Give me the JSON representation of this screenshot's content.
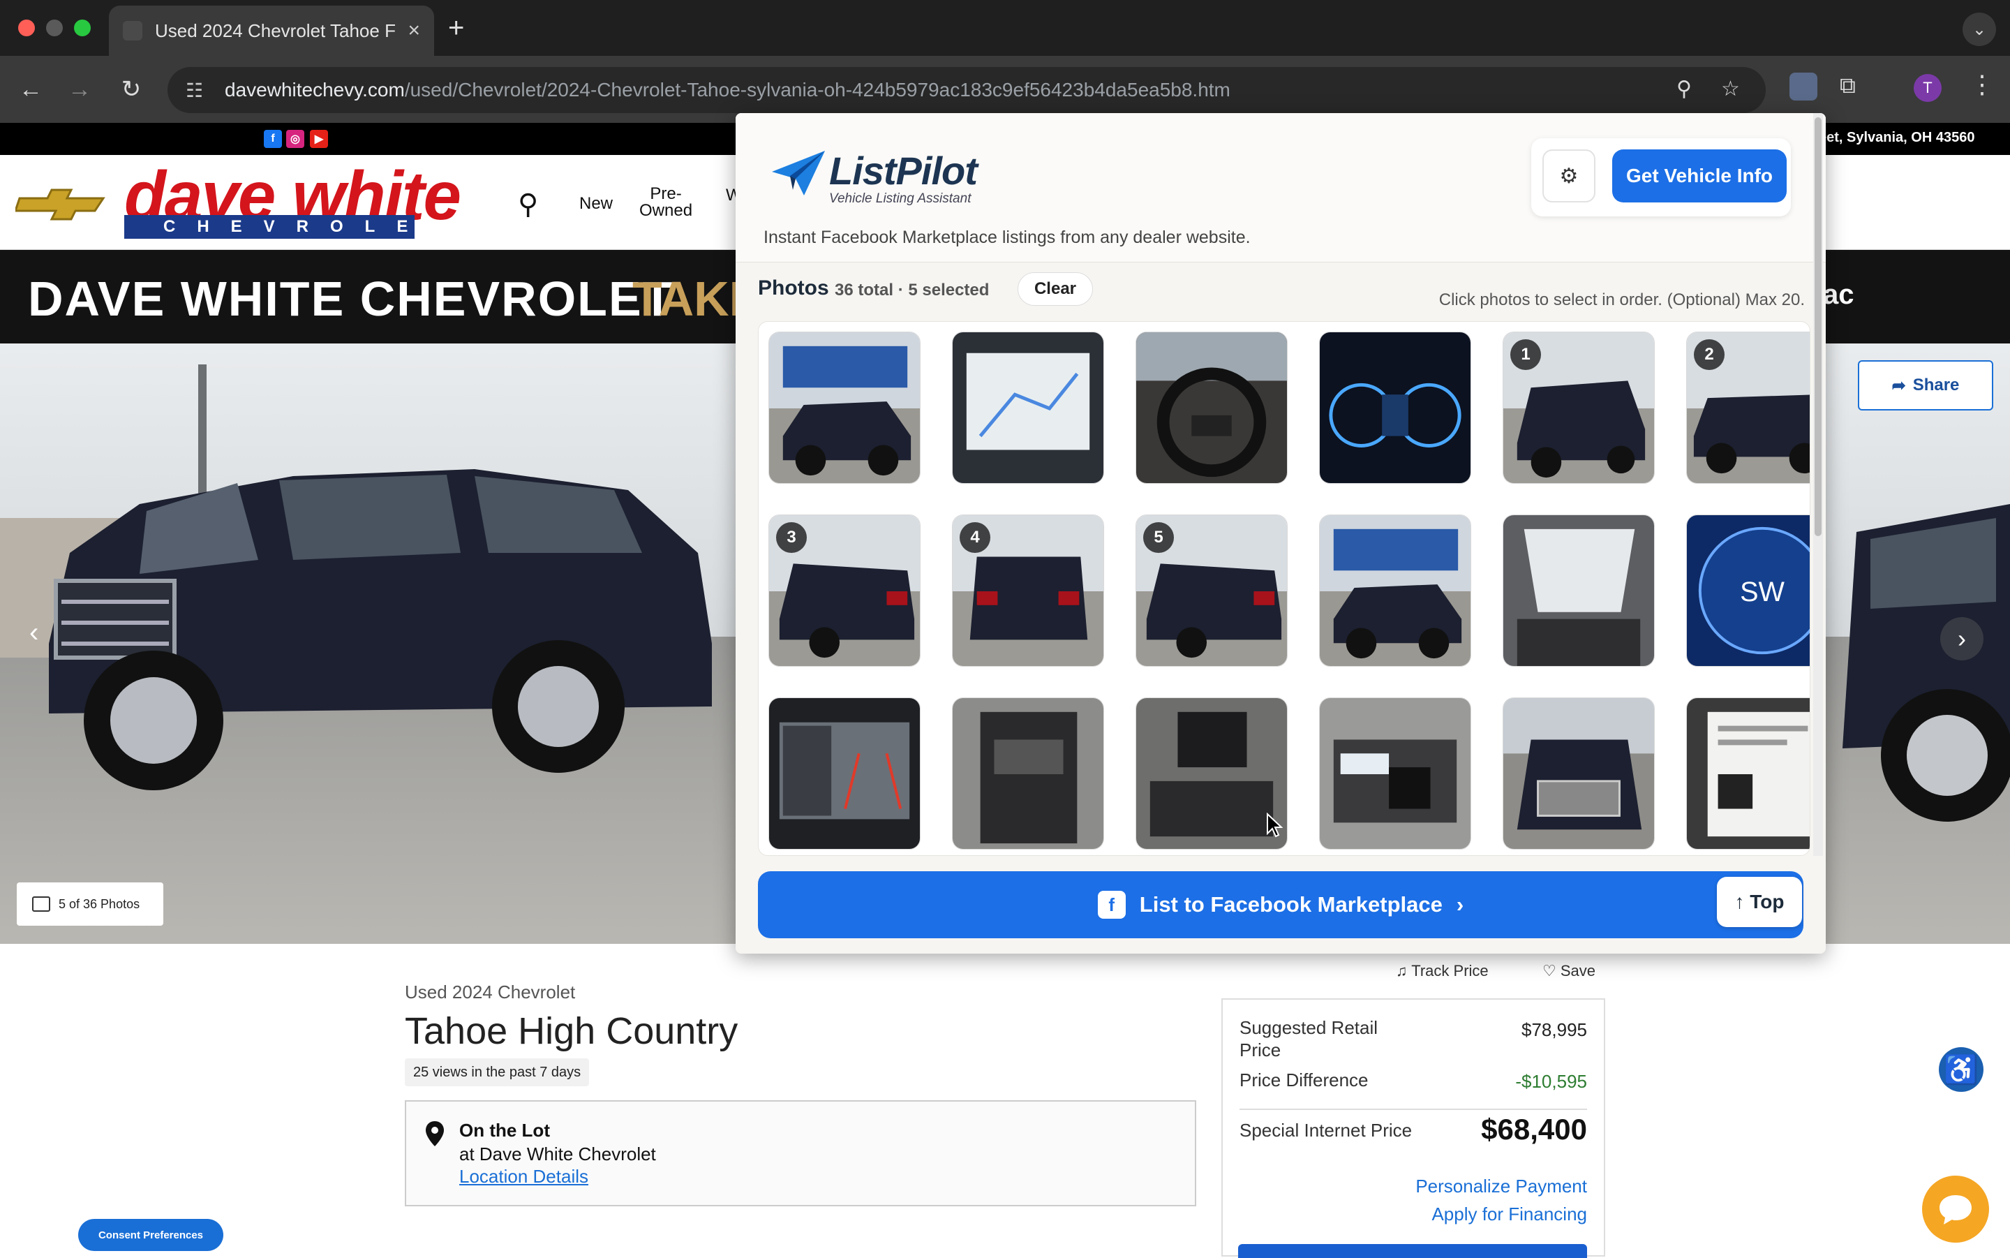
{
  "browser": {
    "tab_title": "Used 2024 Chevrolet Tahoe F",
    "new_tab": "+",
    "url_host": "davewhitechevy.com",
    "url_path": "/used/Chevrolet/2024-Chevrolet-Tahoe-sylvania-oh-424b5979ac183c9ef56423b4da5ea5b8.htm",
    "profile_initial": "T"
  },
  "site": {
    "social": [
      "f",
      "◎",
      "▶"
    ],
    "address_partial": "eet, Sylvania, OH 43560",
    "logo_top": "dave white",
    "logo_bottom": "CHEVROLET",
    "nav": {
      "new": "New",
      "pre_owned_1": "Pre-",
      "pre_owned_2": "Owned",
      "cut": "W"
    },
    "banner_main": "DAVE WHITE CHEVROLET",
    "banner_gold": "TAKE",
    "banner_right": "ac",
    "share": "Share",
    "photo_count": "5 of 36 Photos"
  },
  "vehicle": {
    "subtitle": "Used 2024 Chevrolet",
    "title": "Tahoe High Country",
    "views": "25 views in the past 7 days",
    "location_title": "On the Lot",
    "location_at": "at Dave White Chevrolet",
    "location_link": "Location Details",
    "track_price": "Track Price",
    "save": "Save"
  },
  "pricing": {
    "msrp_label": "Suggested Retail Price",
    "msrp_value": "$78,995",
    "diff_label": "Price Difference",
    "diff_value": "-$10,595",
    "sip_label": "Special Internet Price",
    "sip_value": "$68,400",
    "personalize": "Personalize Payment",
    "financing": "Apply for Financing"
  },
  "consent": "Consent Preferences",
  "listpilot": {
    "logo": "ListPilot",
    "logo_sub": "Vehicle Listing Assistant",
    "tagline": "Instant Facebook Marketplace listings from any dealer website.",
    "get_info": "Get Vehicle Info",
    "photos_label": "Photos",
    "photos_count": "36 total · 5 selected",
    "clear": "Clear",
    "hint": "Click photos to select in order. (Optional) Max 20.",
    "list_button": "List to Facebook Marketplace",
    "top_button": "↑ Top",
    "thumbs": [
      {
        "kind": "car-dealer",
        "badge": ""
      },
      {
        "kind": "screen-map",
        "badge": ""
      },
      {
        "kind": "steering",
        "badge": ""
      },
      {
        "kind": "cluster",
        "badge": ""
      },
      {
        "kind": "car-front",
        "badge": "1"
      },
      {
        "kind": "car-side",
        "badge": "2"
      },
      {
        "kind": "car-rear3q",
        "badge": "3"
      },
      {
        "kind": "car-rear",
        "badge": "4"
      },
      {
        "kind": "car-rear3q",
        "badge": "5"
      },
      {
        "kind": "car-dealer",
        "badge": ""
      },
      {
        "kind": "sunroof",
        "badge": ""
      },
      {
        "kind": "compass",
        "badge": ""
      },
      {
        "kind": "camera",
        "badge": ""
      },
      {
        "kind": "console",
        "badge": ""
      },
      {
        "kind": "dash",
        "badge": ""
      },
      {
        "kind": "keys",
        "badge": ""
      },
      {
        "kind": "car-grille",
        "badge": ""
      },
      {
        "kind": "sticker",
        "badge": ""
      },
      {
        "kind": "partial",
        "badge": ""
      },
      {
        "kind": "partial",
        "badge": ""
      },
      {
        "kind": "partial",
        "badge": ""
      },
      {
        "kind": "partial",
        "badge": ""
      },
      {
        "kind": "partial",
        "badge": ""
      },
      {
        "kind": "partial",
        "badge": ""
      }
    ]
  }
}
